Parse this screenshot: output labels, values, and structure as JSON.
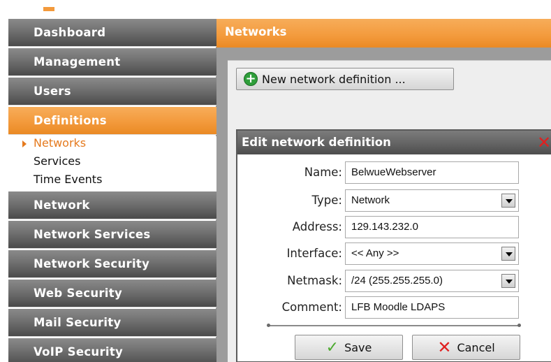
{
  "sidebar": {
    "items": [
      {
        "label": "Dashboard"
      },
      {
        "label": "Management"
      },
      {
        "label": "Users"
      },
      {
        "label": "Definitions"
      },
      {
        "label": "Network"
      },
      {
        "label": "Network Services"
      },
      {
        "label": "Network Security"
      },
      {
        "label": "Web Security"
      },
      {
        "label": "Mail Security"
      },
      {
        "label": "VoIP Security"
      }
    ],
    "active_item": "Definitions",
    "submenu": [
      {
        "label": "Networks",
        "current": true
      },
      {
        "label": "Services"
      },
      {
        "label": "Time Events"
      }
    ]
  },
  "header": {
    "title": "Networks"
  },
  "toolbar": {
    "new_label": "New network definition ...",
    "new_icon": "plus-icon"
  },
  "dialog": {
    "title": "Edit network definition",
    "fields": {
      "name": {
        "label": "Name:",
        "value": "BelwueWebserver"
      },
      "type": {
        "label": "Type:",
        "value": "Network"
      },
      "address": {
        "label": "Address:",
        "value": "129.143.232.0"
      },
      "interface": {
        "label": "Interface:",
        "value": "<< Any >>"
      },
      "netmask": {
        "label": "Netmask:",
        "value": "/24 (255.255.255.0)"
      },
      "comment": {
        "label": "Comment:",
        "value": "LFB Moodle LDAPS"
      }
    },
    "save_label": "Save",
    "cancel_label": "Cancel"
  },
  "colors": {
    "accent": "#f39a3c",
    "nav_dark": "#5c5c5c",
    "current_link": "#e57a1e"
  }
}
